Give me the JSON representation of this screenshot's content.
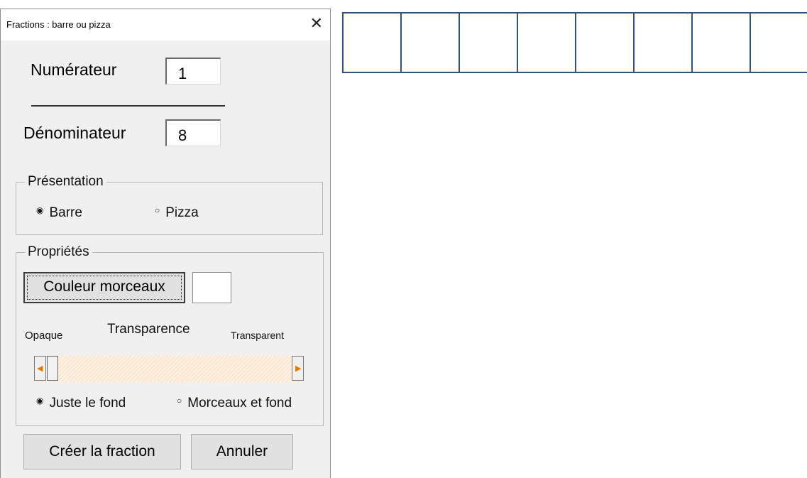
{
  "dialog": {
    "title": "Fractions : barre ou pizza",
    "close_glyph": "✕",
    "numerator_label": "Numérateur",
    "numerator_value": "1",
    "denominator_label": "Dénominateur",
    "denominator_value": "8",
    "presentation": {
      "legend": "Présentation",
      "options": [
        {
          "label": "Barre",
          "checked": true
        },
        {
          "label": "Pizza",
          "checked": false
        }
      ]
    },
    "properties": {
      "legend": "Propriétés",
      "color_button": "Couleur morceaux",
      "transparency_label": "Transparence",
      "opaque_label": "Opaque",
      "transparent_label": "Transparent",
      "transparency_value": 0,
      "options": [
        {
          "label": "Juste le fond",
          "checked": true
        },
        {
          "label": "Morceaux et fond",
          "checked": false
        }
      ]
    },
    "create_button": "Créer la fraction",
    "cancel_button": "Annuler"
  },
  "fraction_bar": {
    "segments": 8,
    "border_color": "#31527f",
    "fill_color": "#ffffff"
  }
}
